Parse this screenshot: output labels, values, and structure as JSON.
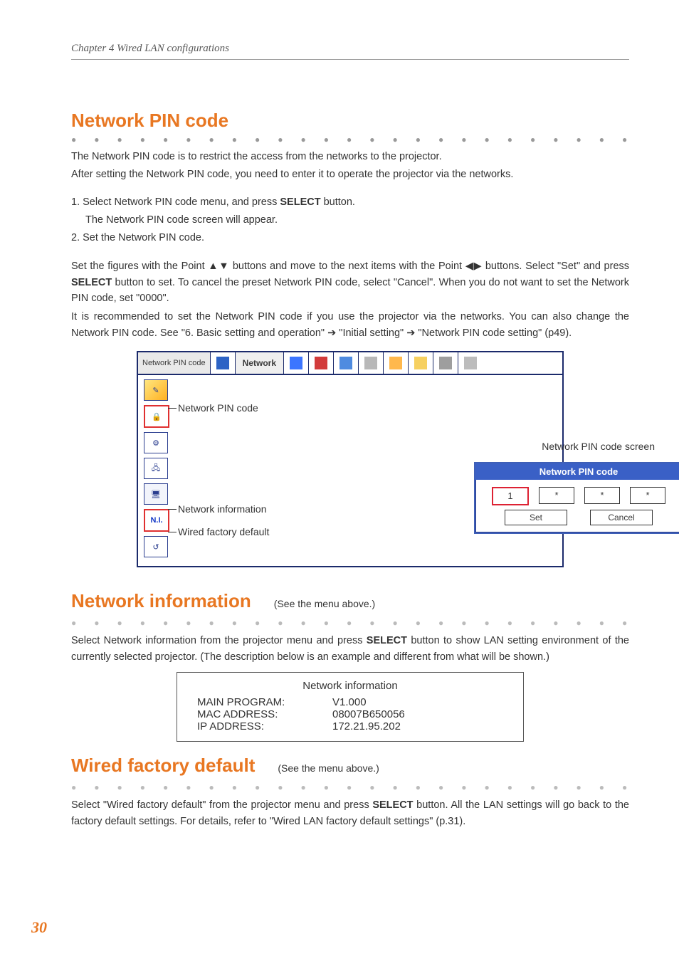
{
  "chapter": "Chapter 4 Wired LAN configurations",
  "section1": {
    "heading": "Network PIN code",
    "p1": "The Network PIN code is to restrict the access from the networks to the projector.",
    "p2": "After setting the Network PIN code, you need to enter it to operate the projector via the networks.",
    "li1": "1. Select Network PIN code menu, and press SELECT button.",
    "li1b": "The Network PIN code screen will appear.",
    "li2": "2. Set the Network PIN code.",
    "p3a": "Set the figures with the Point ",
    "p3b": " buttons and move to the next items with the Point ",
    "p3c": " buttons. Select \"Set\" and press ",
    "p3d": " button to set. To cancel the preset Network PIN code, select \"Cancel\". When you do not want to set the Network PIN code, set \"0000\".",
    "p4a": "It is recommended to set the Network PIN code if you use the projector via the networks. You can also change the Network PIN code. See \"6. Basic setting and operation\" ",
    "p4b": " \"Initial setting\" ",
    "p4c": " \"Network PIN code setting\" (p49).",
    "select_word": "SELECT",
    "arrow_ud": "▲▼",
    "arrow_lr": "◀▶",
    "arrow_r": "➔"
  },
  "menu": {
    "tab_label": "Network PIN code",
    "network_tab": "Network",
    "callout_pin": "Network PIN code",
    "callout_ninfo": "Network information",
    "callout_factory": "Wired factory default",
    "pin_caption": "Network PIN code screen",
    "ni_label": "N.I.",
    "pin_dialog": {
      "title": "Network PIN code",
      "d1": "1",
      "d2": "*",
      "d3": "*",
      "d4": "*",
      "set": "Set",
      "cancel": "Cancel"
    }
  },
  "section2": {
    "heading": "Network information",
    "see": "(See the menu above.)",
    "p1a": "Select Network information from the projector menu and press ",
    "p1b": " button to show LAN setting environment of the currently selected projector. (The description below is an example and different from what will be shown.)"
  },
  "infobox": {
    "title": "Network information",
    "rows": [
      {
        "k": "MAIN PROGRAM:",
        "v": "V1.000"
      },
      {
        "k": "MAC ADDRESS:",
        "v": "08007B650056"
      },
      {
        "k": "IP ADDRESS:",
        "v": "172.21.95.202"
      }
    ]
  },
  "section3": {
    "heading": "Wired factory default",
    "see": "(See the menu above.)",
    "p1a": "Select \"Wired factory default\" from the projector menu and press ",
    "p1b": " button.  All the LAN settings will go back to the factory default settings. For details, refer to \"Wired LAN factory default settings\" (p.31)."
  },
  "pagenum": "30"
}
